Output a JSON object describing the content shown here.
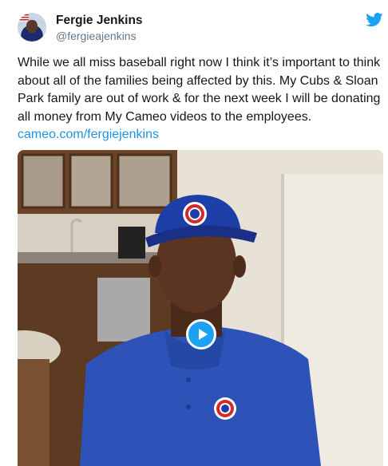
{
  "author": {
    "name": "Fergie Jenkins",
    "handle": "@fergieajenkins"
  },
  "tweet": {
    "text": "While we all miss baseball right now I think it’s important to think about all of the families being affected by this. My Cubs & Sloan Park family are out of work & for the next week I will be donating all money from My Cameo videos to the employees.",
    "link": "cameo.com/fergiejenkins"
  },
  "media": {
    "type": "video",
    "play_icon": "play-icon"
  },
  "colors": {
    "brand": "#1da1f2",
    "link": "#1b95e0",
    "handle": "#657786"
  }
}
